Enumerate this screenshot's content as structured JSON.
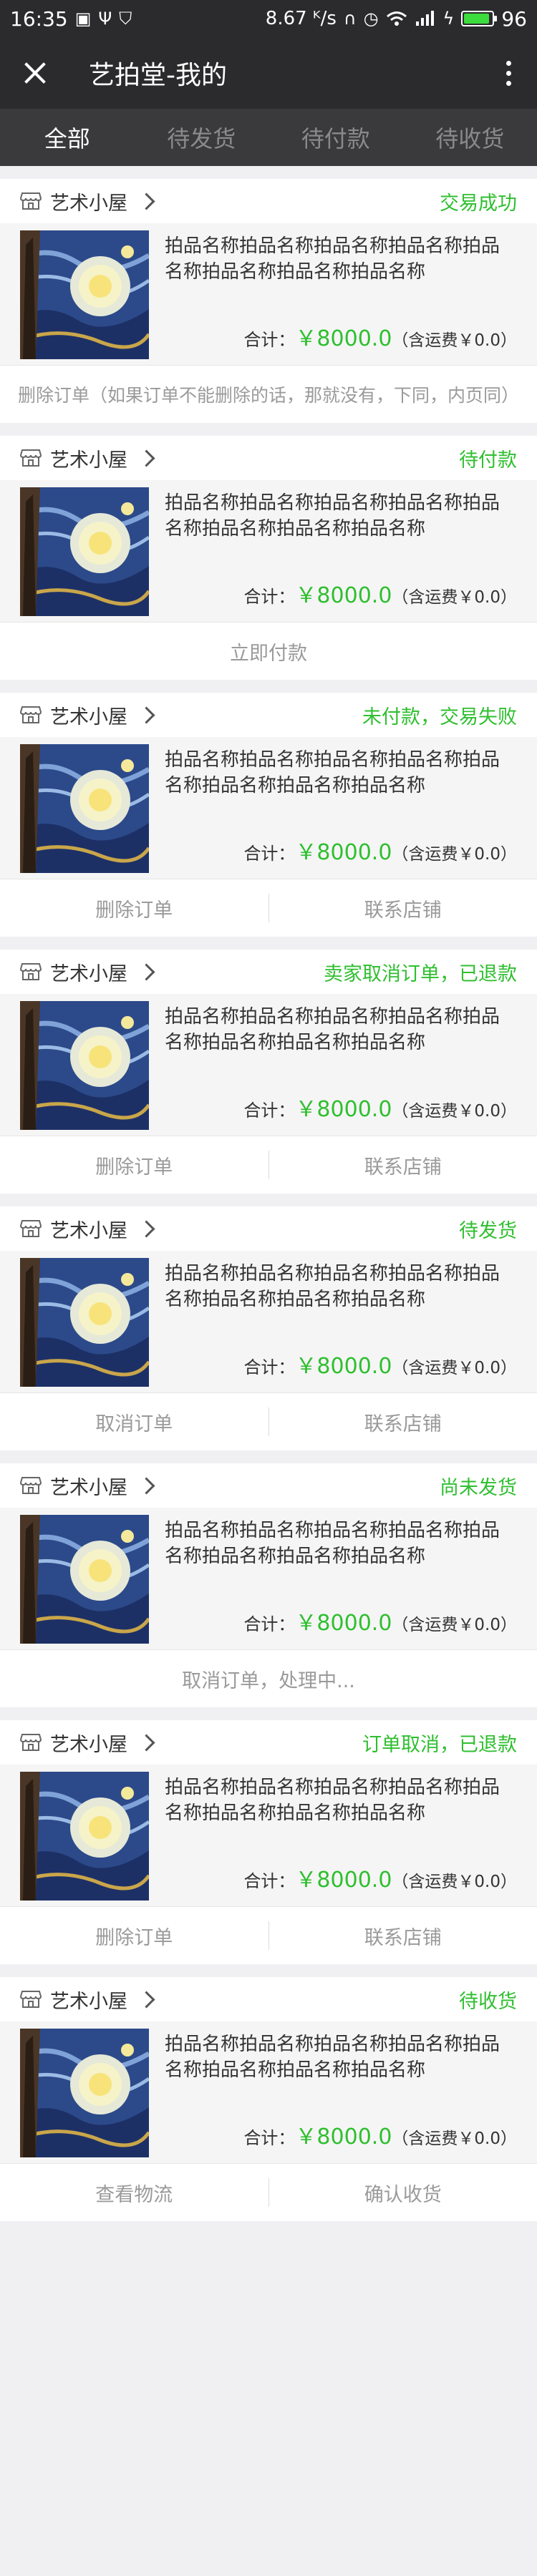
{
  "status_bar": {
    "time": "16:35",
    "network_speed": "8.67 ᴷ/s",
    "battery": "96",
    "battery_level": 0.96,
    "battery_color": "#3cdc3c",
    "icons": [
      "image-icon",
      "usb-icon",
      "shield-icon",
      "headphones-icon",
      "alarm-icon",
      "wifi-icon",
      "signal-icon",
      "charging-icon",
      "battery-icon"
    ]
  },
  "navbar": {
    "title": "艺拍堂-我的",
    "close_icon": "close-icon",
    "more_icon": "more-icon"
  },
  "tabs": [
    "全部",
    "待发货",
    "待付款",
    "待收货"
  ],
  "active_tab": 0,
  "colors": {
    "accent_green": "#2fbf2f",
    "header_bg": "#2b2b2d",
    "tab_bg": "#3a3a3c"
  },
  "orders": [
    {
      "shop": "艺术小屋",
      "status": "交易成功",
      "item": "拍品名称拍品名称拍品名称拍品名称拍品名称拍品名称拍品名称拍品名称",
      "total_label": "合计：",
      "price": "￥8000.0",
      "shipping": "（含运费￥0.0）",
      "actions": [
        "删除订单（如果订单不能删除的话，那就没有，下同，内页同）"
      ]
    },
    {
      "shop": "艺术小屋",
      "status": "待付款",
      "item": "拍品名称拍品名称拍品名称拍品名称拍品名称拍品名称拍品名称拍品名称",
      "total_label": "合计：",
      "price": "￥8000.0",
      "shipping": "（含运费￥0.0）",
      "actions": [
        "立即付款"
      ]
    },
    {
      "shop": "艺术小屋",
      "status": "未付款，交易失败",
      "item": "拍品名称拍品名称拍品名称拍品名称拍品名称拍品名称拍品名称拍品名称",
      "total_label": "合计：",
      "price": "￥8000.0",
      "shipping": "（含运费￥0.0）",
      "actions": [
        "删除订单",
        "联系店铺"
      ]
    },
    {
      "shop": "艺术小屋",
      "status": "卖家取消订单，已退款",
      "item": "拍品名称拍品名称拍品名称拍品名称拍品名称拍品名称拍品名称拍品名称",
      "total_label": "合计：",
      "price": "￥8000.0",
      "shipping": "（含运费￥0.0）",
      "actions": [
        "删除订单",
        "联系店铺"
      ]
    },
    {
      "shop": "艺术小屋",
      "status": "待发货",
      "item": "拍品名称拍品名称拍品名称拍品名称拍品名称拍品名称拍品名称拍品名称",
      "total_label": "合计：",
      "price": "￥8000.0",
      "shipping": "（含运费￥0.0）",
      "actions": [
        "取消订单",
        "联系店铺"
      ]
    },
    {
      "shop": "艺术小屋",
      "status": "尚未发货",
      "item": "拍品名称拍品名称拍品名称拍品名称拍品名称拍品名称拍品名称拍品名称",
      "total_label": "合计：",
      "price": "￥8000.0",
      "shipping": "（含运费￥0.0）",
      "actions": [
        "取消订单，处理中..."
      ]
    },
    {
      "shop": "艺术小屋",
      "status": "订单取消，已退款",
      "item": "拍品名称拍品名称拍品名称拍品名称拍品名称拍品名称拍品名称拍品名称",
      "total_label": "合计：",
      "price": "￥8000.0",
      "shipping": "（含运费￥0.0）",
      "actions": [
        "删除订单",
        "联系店铺"
      ]
    },
    {
      "shop": "艺术小屋",
      "status": "待收货",
      "item": "拍品名称拍品名称拍品名称拍品名称拍品名称拍品名称拍品名称拍品名称",
      "total_label": "合计：",
      "price": "￥8000.0",
      "shipping": "（含运费￥0.0）",
      "actions": [
        "查看物流",
        "确认收货"
      ]
    }
  ]
}
